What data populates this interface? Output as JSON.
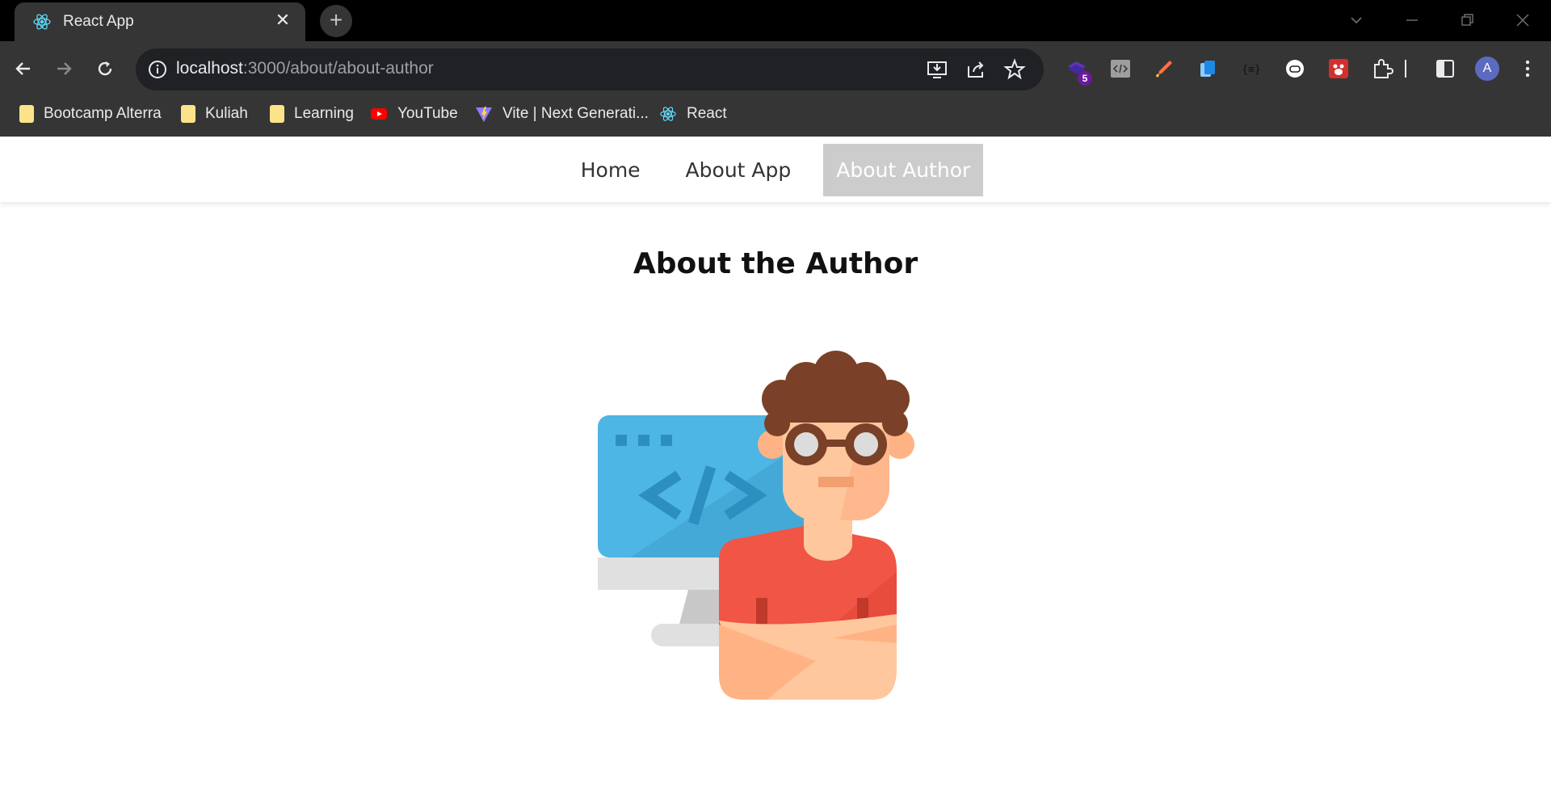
{
  "browser": {
    "tab_title": "React App",
    "url_host": "localhost",
    "url_path": ":3000/about/about-author",
    "extension_badge": "5",
    "profile_initial": "A",
    "bookmarks": [
      {
        "label": "Bootcamp Alterra",
        "icon": "folder-icon"
      },
      {
        "label": "Kuliah",
        "icon": "folder-icon"
      },
      {
        "label": "Learning",
        "icon": "folder-icon"
      },
      {
        "label": "YouTube",
        "icon": "youtube-icon"
      },
      {
        "label": "Vite | Next Generati...",
        "icon": "vite-icon"
      },
      {
        "label": "React",
        "icon": "react-icon"
      }
    ]
  },
  "site": {
    "nav": [
      {
        "label": "Home",
        "active": false
      },
      {
        "label": "About App",
        "active": false
      },
      {
        "label": "About Author",
        "active": true
      }
    ],
    "heading": "About the Author",
    "illustration": "developer-avatar-illustration"
  },
  "colors": {
    "chrome_dark": "#353535",
    "titlebar": "#000000",
    "active_nav_bg": "#cccccc",
    "monitor_blue": "#4db6e5",
    "shirt_red": "#f05545",
    "hair_brown": "#7a4128",
    "skin": "#ffc79e"
  }
}
